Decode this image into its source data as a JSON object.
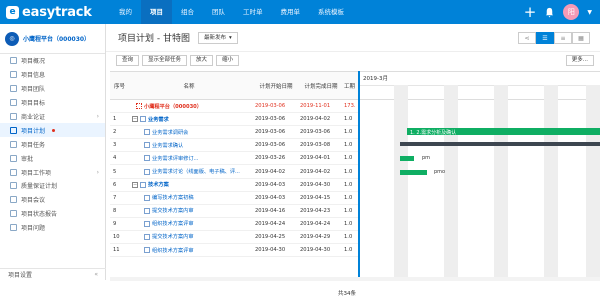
{
  "app": {
    "logo_text": "easytrack"
  },
  "nav": {
    "items": [
      "我的",
      "项目",
      "组合",
      "团队",
      "工时单",
      "费用单",
      "系统模板"
    ],
    "active_index": 1
  },
  "user": {
    "avatar_text": "阳"
  },
  "sidebar": {
    "project_icon_text": "◎",
    "project_name": "小鹰程平台（000030）",
    "items": [
      {
        "label": "项目概况",
        "active": false
      },
      {
        "label": "项目信息",
        "active": false
      },
      {
        "label": "项目团队",
        "active": false
      },
      {
        "label": "项目目标",
        "active": false
      },
      {
        "label": "商业论证",
        "active": false,
        "expandable": true
      },
      {
        "label": "项目计划",
        "active": true,
        "badge": true
      },
      {
        "label": "项目任务",
        "active": false
      },
      {
        "label": "审批",
        "active": false
      },
      {
        "label": "项目工作项",
        "active": false,
        "expandable": true
      },
      {
        "label": "质量保证计划",
        "active": false
      },
      {
        "label": "项目会议",
        "active": false
      },
      {
        "label": "项目状态报告",
        "active": false
      },
      {
        "label": "项目问题",
        "active": false
      }
    ],
    "footer_label": "项目设置",
    "collapse_glyph": "«"
  },
  "page": {
    "title": "项目计划 - 甘特图",
    "status_select": "最新发布"
  },
  "toolbar": {
    "buttons": [
      "查询",
      "显示全部任务",
      "放大",
      "缩小"
    ],
    "more": "更多..."
  },
  "grid": {
    "headers": {
      "seq": "序号",
      "name": "名称",
      "start": "计划开始日期",
      "end": "计划完成日期",
      "work": "工期"
    },
    "rows": [
      {
        "seq": "",
        "name": "小鹰程平台（000030）",
        "start": "2019-03-06",
        "end": "2019-11-01",
        "work": "173.",
        "level": 0,
        "type": "project"
      },
      {
        "seq": "1",
        "name": "业务需求",
        "start": "2019-03-06",
        "end": "2019-04-02",
        "work": "1.0",
        "level": 1,
        "type": "group"
      },
      {
        "seq": "2",
        "name": "业务需求调研会",
        "start": "2019-03-06",
        "end": "2019-03-06",
        "work": "1.0",
        "level": 2,
        "type": "task"
      },
      {
        "seq": "3",
        "name": "业务需求确认",
        "start": "2019-03-06",
        "end": "2019-03-08",
        "work": "1.0",
        "level": 2,
        "type": "task"
      },
      {
        "seq": "4",
        "name": "业务需求评审修订...",
        "start": "2019-03-26",
        "end": "2019-04-01",
        "work": "1.0",
        "level": 2,
        "type": "task"
      },
      {
        "seq": "5",
        "name": "业务需求讨论（线面版、电子稿、评...",
        "start": "2019-04-02",
        "end": "2019-04-02",
        "work": "1.0",
        "level": 2,
        "type": "task"
      },
      {
        "seq": "6",
        "name": "技术方案",
        "start": "2019-04-03",
        "end": "2019-04-30",
        "work": "1.0",
        "level": 1,
        "type": "group"
      },
      {
        "seq": "7",
        "name": "编写技术方案初稿",
        "start": "2019-04-03",
        "end": "2019-04-15",
        "work": "1.0",
        "level": 2,
        "type": "task"
      },
      {
        "seq": "8",
        "name": "提交技术方案内审",
        "start": "2019-04-16",
        "end": "2019-04-23",
        "work": "1.0",
        "level": 2,
        "type": "task"
      },
      {
        "seq": "9",
        "name": "组织技术方案评审",
        "start": "2019-04-24",
        "end": "2019-04-24",
        "work": "1.0",
        "level": 2,
        "type": "task"
      },
      {
        "seq": "10",
        "name": "提交技术方案内审",
        "start": "2019-04-25",
        "end": "2019-04-29",
        "work": "1.0",
        "level": 2,
        "type": "task"
      },
      {
        "seq": "11",
        "name": "组织技术方案评审",
        "start": "2019-04-30",
        "end": "2019-04-30",
        "work": "1.0",
        "level": 2,
        "type": "task"
      }
    ],
    "total_label": "共34条"
  },
  "gantt": {
    "month_label": "2019-3月",
    "bars": [
      {
        "label": "1. 2.需求分析及确认",
        "type": "summary-green"
      },
      {
        "label": "",
        "type": "dark"
      },
      {
        "label": "pm",
        "type": "task"
      },
      {
        "label": "pmo",
        "type": "task"
      }
    ]
  },
  "colors": {
    "brand": "#0082d8",
    "bar": "#0fae63",
    "project_text": "#e0301e"
  }
}
